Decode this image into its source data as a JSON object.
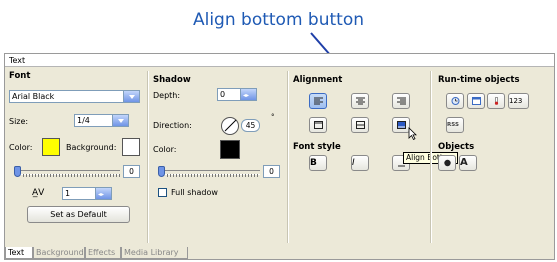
{
  "callout": {
    "text": "Align bottom button",
    "color": "#1f5ab4"
  },
  "window": {
    "title": "Text"
  },
  "font": {
    "header": "Font",
    "family_value": "Arial Black",
    "size_label": "Size:",
    "size_value": "1/4",
    "color_label": "Color:",
    "color_value": "#ffff00",
    "background_label": "Background:",
    "background_value": "#ffffff",
    "opacity_value": "0",
    "spacing_value": "1",
    "set_default_label": "Set as Default"
  },
  "shadow": {
    "header": "Shadow",
    "depth_label": "Depth:",
    "depth_value": "0",
    "direction_label": "Direction:",
    "direction_value": "45",
    "degree_symbol": "°",
    "color_label": "Color:",
    "color_value": "#000000",
    "opacity_value": "0",
    "full_shadow_label": "Full shadow"
  },
  "alignment": {
    "header": "Alignment",
    "tooltip": "Align Bottom"
  },
  "font_style": {
    "header": "Font style",
    "bold_glyph": "B",
    "italic_glyph": "I"
  },
  "runtime": {
    "header": "Run-time objects",
    "counter_glyph": "123",
    "rss_glyph": "RSS"
  },
  "objects": {
    "header": "Objects"
  },
  "tabs": [
    "Text",
    "Background",
    "Effects",
    "Media Library"
  ],
  "highlight_color": "#1f3fa8"
}
